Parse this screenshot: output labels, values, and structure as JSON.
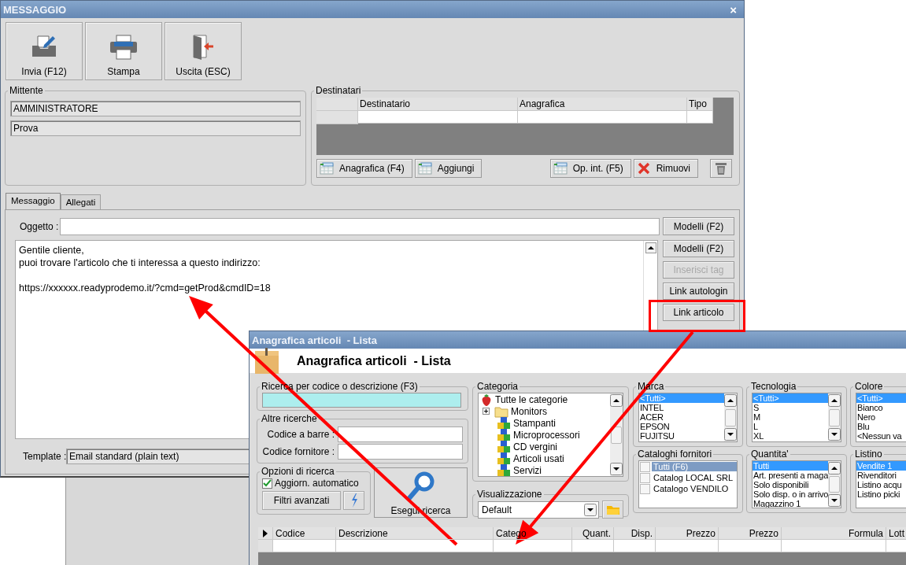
{
  "window": {
    "title": "MESSAGGIO",
    "close": "×"
  },
  "toolbar": [
    {
      "label": "Invia (F12)",
      "kind": "send"
    },
    {
      "label": "Stampa",
      "kind": "print"
    },
    {
      "label": "Uscita (ESC)",
      "kind": "exit"
    }
  ],
  "sender": {
    "title": "Mittente",
    "fields": [
      "AMMINISTRATORE",
      "Prova"
    ]
  },
  "recipients": {
    "title": "Destinatari",
    "columns": [
      "Destinatario",
      "Anagrafica",
      "Tipo"
    ],
    "buttons": [
      {
        "label": "Anagrafica (F4)",
        "kind": "grid"
      },
      {
        "label": "Aggiungi",
        "kind": "grid"
      },
      {
        "label": "Op. int. (F5)",
        "kind": "grid"
      },
      {
        "label": "Rimuovi",
        "kind": "remove"
      },
      {
        "kind": "trash"
      }
    ]
  },
  "tabs": [
    {
      "label": "Messaggio",
      "selected": true
    },
    {
      "label": "Allegati",
      "selected": false
    }
  ],
  "message": {
    "subject_label": "Oggetto :",
    "subject_button": "Modelli (F2)",
    "body": [
      "Gentile cliente,\npuoi trovare l'articolo che ti interessa a questo indirizzo:",
      "https://xxxxxx.readyprodemo.it/?cmd=getProd&cmdID=18"
    ],
    "side_buttons": [
      {
        "label": "Modelli (F2)",
        "disabled": false
      },
      {
        "label": "Inserisci tag",
        "disabled": true
      },
      {
        "label": "Link autologin",
        "disabled": false
      },
      {
        "label": "Link articolo",
        "disabled": false
      }
    ],
    "template_label": "Template :",
    "template": "Email standard (plain text)"
  },
  "articles_window": {
    "title": "Anagrafica articoli  - Lista",
    "heading": "Anagrafica articoli  - Lista",
    "search": {
      "title": "Ricerca per codice o descrizione (F3)"
    },
    "other_searches": {
      "title": "Altre ricerche",
      "fields": [
        "Codice a barre :",
        "Codice fornitore :"
      ]
    },
    "options": {
      "title": "Opzioni di ricerca",
      "auto_update": {
        "label": "Aggiorn. automatico",
        "checked": true
      },
      "filters_button": "Filtri avanzati"
    },
    "run_button": "Esegui ricerca",
    "category": {
      "title": "Categoria",
      "tree": [
        {
          "label": "Tutte le categorie",
          "kind": "root",
          "children": [
            {
              "label": "Monitors",
              "kind": "folder",
              "expanded": false
            },
            {
              "label": "Stampanti",
              "kind": "cubes"
            },
            {
              "label": "Microprocessori",
              "kind": "cubes"
            },
            {
              "label": "CD vergini",
              "kind": "cubes"
            },
            {
              "label": "Articoli usati",
              "kind": "cubes"
            },
            {
              "label": "Servizi",
              "kind": "cubes"
            }
          ]
        }
      ]
    },
    "view": {
      "title": "Visualizzazione",
      "value": "Default"
    },
    "lists": [
      {
        "title": "Marca",
        "kind": "list",
        "scrollbar": true,
        "items": [
          {
            "label": "<Tutti>",
            "selected": true
          },
          {
            "label": "INTEL",
            "selected": false
          },
          {
            "label": "ACER",
            "selected": false
          },
          {
            "label": "EPSON",
            "selected": false
          },
          {
            "label": "FUJITSU",
            "selected": false
          }
        ]
      },
      {
        "title": "Tecnologia",
        "kind": "list",
        "scrollbar": true,
        "items": [
          {
            "label": "<Tutti>",
            "selected": true
          },
          {
            "label": "S",
            "selected": false
          },
          {
            "label": "M",
            "selected": false
          },
          {
            "label": "L",
            "selected": false
          },
          {
            "label": "XL",
            "selected": false
          }
        ]
      },
      {
        "title": "Colore",
        "kind": "list",
        "scrollbar": false,
        "items": [
          {
            "label": "<Tutti>",
            "selected": true
          },
          {
            "label": "Bianco",
            "selected": false
          },
          {
            "label": "Nero",
            "selected": false
          },
          {
            "label": "Blu",
            "selected": false
          },
          {
            "label": "<Nessun va",
            "selected": false
          }
        ]
      },
      {
        "title": "Cataloghi fornitori",
        "kind": "checklist",
        "scrollbar": false,
        "items": [
          {
            "label": "Tutti (F6)",
            "selected": true,
            "checked": false
          },
          {
            "label": "Catalog LOCAL SRL",
            "selected": false,
            "checked": false
          },
          {
            "label": "Catalogo VENDILO",
            "selected": false,
            "checked": false
          }
        ]
      },
      {
        "title": "Quantita'",
        "kind": "list",
        "scrollbar": true,
        "items": [
          {
            "label": "Tutti",
            "selected": true
          },
          {
            "label": "Art. presenti a maga",
            "selected": false
          },
          {
            "label": "Solo disponibili",
            "selected": false
          },
          {
            "label": "Solo disp. o in arrivo",
            "selected": false
          },
          {
            "label": "Magazzino 1",
            "selected": false
          }
        ]
      },
      {
        "title": "Listino",
        "kind": "list",
        "scrollbar": false,
        "items": [
          {
            "label": "Vendite 1",
            "selected": true
          },
          {
            "label": "Rivenditori",
            "selected": false
          },
          {
            "label": "Listino acqu",
            "selected": false
          },
          {
            "label": "Listino picki",
            "selected": false
          }
        ]
      }
    ],
    "grid": {
      "columns": [
        {
          "label": "Codice",
          "kind": "text"
        },
        {
          "label": "Descrizione",
          "kind": "text"
        },
        {
          "label": "Catego",
          "kind": "text"
        },
        {
          "label": "Quant.",
          "kind": "number"
        },
        {
          "label": "Disp.",
          "kind": "number"
        },
        {
          "label": "Prezzo",
          "kind": "number"
        },
        {
          "label": "Prezzo",
          "kind": "number"
        },
        {
          "label": "Formula",
          "kind": "number"
        },
        {
          "label": "Lott",
          "kind": "text"
        }
      ]
    }
  }
}
